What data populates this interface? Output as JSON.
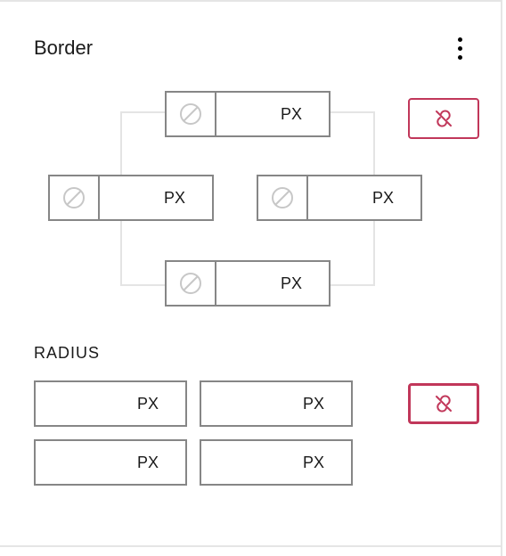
{
  "section": {
    "title": "Border"
  },
  "border": {
    "top": {
      "unit": "PX",
      "value": ""
    },
    "left": {
      "unit": "PX",
      "value": ""
    },
    "right": {
      "unit": "PX",
      "value": ""
    },
    "bottom": {
      "unit": "PX",
      "value": ""
    }
  },
  "radius": {
    "label": "Radius",
    "tl": {
      "unit": "PX",
      "value": ""
    },
    "tr": {
      "unit": "PX",
      "value": ""
    },
    "bl": {
      "unit": "PX",
      "value": ""
    },
    "br": {
      "unit": "PX",
      "value": ""
    }
  }
}
